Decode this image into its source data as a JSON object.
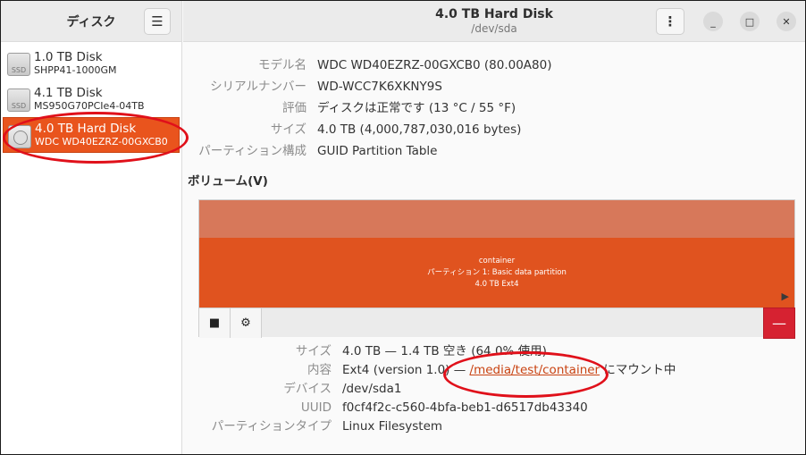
{
  "sidebar": {
    "title": "ディスク",
    "menu_icon": "hamburger-icon",
    "drives": [
      {
        "name": "1.0 TB Disk",
        "model": "SHPP41-1000GM",
        "icon": "ssd-icon",
        "icon_label": "SSD",
        "selected": false
      },
      {
        "name": "4.1 TB Disk",
        "model": "MS950G70PCIe4-04TB",
        "icon": "ssd-icon",
        "icon_label": "SSD",
        "selected": false
      },
      {
        "name": "4.0 TB Hard Disk",
        "model": "WDC WD40EZRZ-00GXCB0",
        "icon": "hdd-icon",
        "selected": true
      }
    ]
  },
  "header": {
    "title": "4.0 TB Hard Disk",
    "subtitle": "/dev/sda",
    "kebab": "⋮",
    "min": "_",
    "max": "□",
    "close": "✕"
  },
  "disk": {
    "model_label": "モデル名",
    "model_value": "WDC WD40EZRZ-00GXCB0 (80.00A80)",
    "serial_label": "シリアルナンバー",
    "serial_value": "WD-WCC7K6XKNY9S",
    "assessment_label": "評価",
    "assessment_value": "ディスクは正常です (13 °C / 55 °F)",
    "size_label": "サイズ",
    "size_value": "4.0 TB (4,000,787,030,016 bytes)",
    "partitioning_label": "パーティション構成",
    "partitioning_value": "GUID Partition Table"
  },
  "volumes": {
    "title": "ボリューム(V)",
    "partition": {
      "line1": "container",
      "line2": "パーティション 1: Basic data partition",
      "line3": "4.0 TB Ext4"
    },
    "play_arrow": "▶",
    "stop_icon": "■",
    "gear_icon": "⚙",
    "minus_icon": "—"
  },
  "details": {
    "size_label": "サイズ",
    "size_value": "4.0 TB — 1.4 TB 空き (64.0% 使用)",
    "content_label": "内容",
    "content_prefix": "Ext4 (version 1.0) — ",
    "content_link": "/media/test/container",
    "content_suffix": " にマウント中",
    "device_label": "デバイス",
    "device_value": "/dev/sda1",
    "uuid_label": "UUID",
    "uuid_value": "f0cf4f2c-c560-4bfa-beb1-d6517db43340",
    "ptype_label": "パーティションタイプ",
    "ptype_value": "Linux Filesystem"
  },
  "colors": {
    "accent": "#e9541d",
    "annotation": "#e0101a",
    "destructive": "#d62231"
  }
}
